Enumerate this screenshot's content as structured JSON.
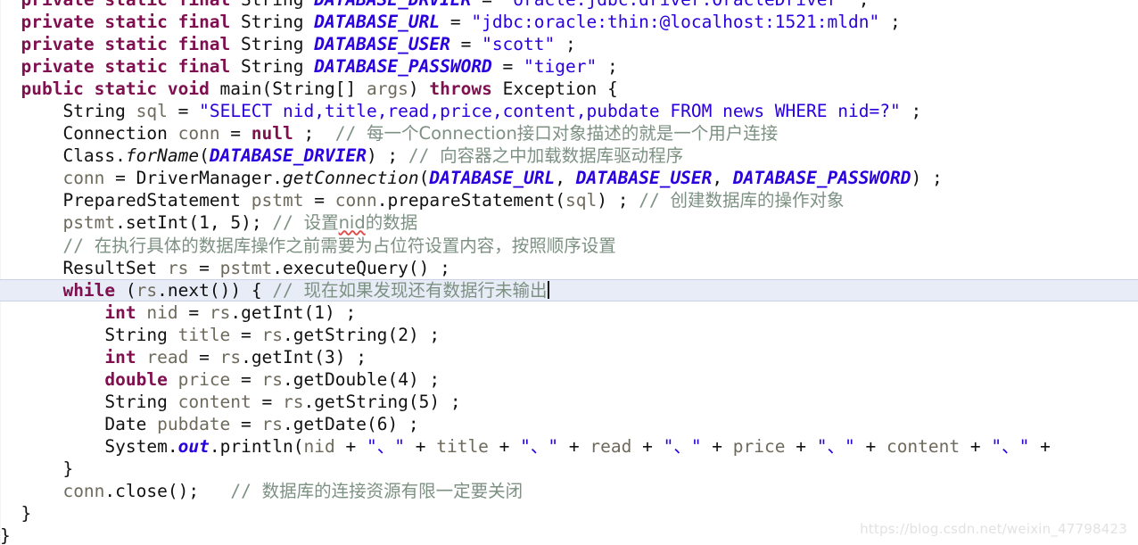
{
  "editor": {
    "language": "Java",
    "theme": {
      "background": "#ffffff",
      "keyword": "#7f0f4f",
      "string": "#2b00de",
      "comment": "#7d9183",
      "field": "#2b00de",
      "variable": "#6e6a5c",
      "text": "#111111",
      "line_highlight": "#e8ecf7",
      "spellcheck_underline": "#e04b4b",
      "watermark": "#e2e2e2"
    },
    "caret_line_index": 11,
    "caret_after_text": "现在如果发现还有数据行未输出"
  },
  "watermark": {
    "text": "https://blog.csdn.net/weixin_47798423"
  },
  "code": {
    "lines": [
      {
        "index": 0,
        "clipped": true,
        "indent": "  ",
        "tokens": [
          {
            "t": "kw",
            "v": "private static final "
          },
          {
            "t": "typ",
            "v": "String "
          },
          {
            "t": "fld",
            "v": "DATABASE_DRVIER"
          },
          {
            "t": "pun",
            "v": " = "
          },
          {
            "t": "str",
            "v": "\"oracle.jdbc.driver.OracleDriver\""
          },
          {
            "t": "pun",
            "v": " ;"
          }
        ]
      },
      {
        "index": 1,
        "indent": "  ",
        "tokens": [
          {
            "t": "kw",
            "v": "private static final "
          },
          {
            "t": "typ",
            "v": "String "
          },
          {
            "t": "fld",
            "v": "DATABASE_URL"
          },
          {
            "t": "pun",
            "v": " = "
          },
          {
            "t": "str",
            "v": "\"jdbc:oracle:thin:@localhost:1521:mldn\""
          },
          {
            "t": "pun",
            "v": " ;"
          }
        ]
      },
      {
        "index": 2,
        "indent": "  ",
        "tokens": [
          {
            "t": "kw",
            "v": "private static final "
          },
          {
            "t": "typ",
            "v": "String "
          },
          {
            "t": "fld",
            "v": "DATABASE_USER"
          },
          {
            "t": "pun",
            "v": " = "
          },
          {
            "t": "str",
            "v": "\"scott\""
          },
          {
            "t": "pun",
            "v": " ;"
          }
        ]
      },
      {
        "index": 3,
        "indent": "  ",
        "tokens": [
          {
            "t": "kw",
            "v": "private static final "
          },
          {
            "t": "typ",
            "v": "String "
          },
          {
            "t": "fld",
            "v": "DATABASE_PASSWORD"
          },
          {
            "t": "pun",
            "v": " = "
          },
          {
            "t": "str",
            "v": "\"tiger\""
          },
          {
            "t": "pun",
            "v": " ;"
          }
        ]
      },
      {
        "index": 4,
        "indent": "  ",
        "tokens": [
          {
            "t": "kw",
            "v": "public static void "
          },
          {
            "t": "typ",
            "v": "main"
          },
          {
            "t": "pun",
            "v": "("
          },
          {
            "t": "typ",
            "v": "String"
          },
          {
            "t": "pun",
            "v": "[] "
          },
          {
            "t": "var",
            "v": "args"
          },
          {
            "t": "pun",
            "v": ") "
          },
          {
            "t": "kw",
            "v": "throws "
          },
          {
            "t": "typ",
            "v": "Exception"
          },
          {
            "t": "pun",
            "v": " {"
          }
        ]
      },
      {
        "index": 5,
        "indent": "      ",
        "tokens": [
          {
            "t": "typ",
            "v": "String "
          },
          {
            "t": "var",
            "v": "sql"
          },
          {
            "t": "pun",
            "v": " = "
          },
          {
            "t": "str",
            "v": "\"SELECT nid,title,read,price,content,pubdate FROM news WHERE nid=?\""
          },
          {
            "t": "pun",
            "v": " ;"
          }
        ]
      },
      {
        "index": 6,
        "indent": "      ",
        "tokens": [
          {
            "t": "typ",
            "v": "Connection "
          },
          {
            "t": "var",
            "v": "conn"
          },
          {
            "t": "pun",
            "v": " = "
          },
          {
            "t": "kw",
            "v": "null"
          },
          {
            "t": "pun",
            "v": " ;  "
          },
          {
            "t": "cmt",
            "v": "// "
          },
          {
            "t": "cmt-cn",
            "v": "每一个Connection接口对象描述的就是一个用户连接"
          }
        ]
      },
      {
        "index": 7,
        "indent": "      ",
        "tokens": [
          {
            "t": "typ",
            "v": "Class"
          },
          {
            "t": "pun",
            "v": "."
          },
          {
            "t": "smeth",
            "v": "forName"
          },
          {
            "t": "pun",
            "v": "("
          },
          {
            "t": "fld",
            "v": "DATABASE_DRVIER"
          },
          {
            "t": "pun",
            "v": ") ; "
          },
          {
            "t": "cmt",
            "v": "// "
          },
          {
            "t": "cmt-cn",
            "v": "向容器之中加载数据库驱动程序"
          }
        ]
      },
      {
        "index": 8,
        "indent": "      ",
        "tokens": [
          {
            "t": "var",
            "v": "conn"
          },
          {
            "t": "pun",
            "v": " = "
          },
          {
            "t": "typ",
            "v": "DriverManager"
          },
          {
            "t": "pun",
            "v": "."
          },
          {
            "t": "smeth",
            "v": "getConnection"
          },
          {
            "t": "pun",
            "v": "("
          },
          {
            "t": "fld",
            "v": "DATABASE_URL"
          },
          {
            "t": "pun",
            "v": ", "
          },
          {
            "t": "fld",
            "v": "DATABASE_USER"
          },
          {
            "t": "pun",
            "v": ", "
          },
          {
            "t": "fld",
            "v": "DATABASE_PASSWORD"
          },
          {
            "t": "pun",
            "v": ") ;"
          }
        ]
      },
      {
        "index": 9,
        "indent": "      ",
        "tokens": [
          {
            "t": "typ",
            "v": "PreparedStatement "
          },
          {
            "t": "var",
            "v": "pstmt"
          },
          {
            "t": "pun",
            "v": " = "
          },
          {
            "t": "var",
            "v": "conn"
          },
          {
            "t": "pun",
            "v": "."
          },
          {
            "t": "typ",
            "v": "prepareStatement"
          },
          {
            "t": "pun",
            "v": "("
          },
          {
            "t": "var",
            "v": "sql"
          },
          {
            "t": "pun",
            "v": ") ; "
          },
          {
            "t": "cmt",
            "v": "// "
          },
          {
            "t": "cmt-cn",
            "v": "创建数据库的操作对象"
          }
        ]
      },
      {
        "index": 10,
        "indent": "      ",
        "tokens": [
          {
            "t": "var",
            "v": "pstmt"
          },
          {
            "t": "pun",
            "v": "."
          },
          {
            "t": "typ",
            "v": "setInt"
          },
          {
            "t": "pun",
            "v": "("
          },
          {
            "t": "num",
            "v": "1"
          },
          {
            "t": "pun",
            "v": ", "
          },
          {
            "t": "num",
            "v": "5"
          },
          {
            "t": "pun",
            "v": "); "
          },
          {
            "t": "cmt",
            "v": "// "
          },
          {
            "t": "cmt-cn",
            "v": "设置"
          },
          {
            "t": "cmt-cn-spell",
            "v": "nid"
          },
          {
            "t": "cmt-cn",
            "v": "的数据"
          }
        ]
      },
      {
        "index": 11,
        "indent": "      ",
        "tokens": [
          {
            "t": "cmt",
            "v": "// "
          },
          {
            "t": "cmt-cn",
            "v": "在执行具体的数据库操作之前需要为占位符设置内容，按照顺序设置"
          }
        ]
      },
      {
        "index": 12,
        "indent": "      ",
        "tokens": [
          {
            "t": "typ",
            "v": "ResultSet "
          },
          {
            "t": "var",
            "v": "rs"
          },
          {
            "t": "pun",
            "v": " = "
          },
          {
            "t": "var",
            "v": "pstmt"
          },
          {
            "t": "pun",
            "v": "."
          },
          {
            "t": "typ",
            "v": "executeQuery"
          },
          {
            "t": "pun",
            "v": "() ;"
          }
        ]
      },
      {
        "index": 13,
        "highlight": true,
        "caret": true,
        "indent": "      ",
        "tokens": [
          {
            "t": "kw",
            "v": "while "
          },
          {
            "t": "pun",
            "v": "("
          },
          {
            "t": "var",
            "v": "rs"
          },
          {
            "t": "pun",
            "v": "."
          },
          {
            "t": "typ",
            "v": "next"
          },
          {
            "t": "pun",
            "v": "()) { "
          },
          {
            "t": "cmt",
            "v": "// "
          },
          {
            "t": "cmt-cn",
            "v": "现在如果发现还有数据行未输出"
          }
        ]
      },
      {
        "index": 14,
        "indent": "          ",
        "tokens": [
          {
            "t": "kw",
            "v": "int "
          },
          {
            "t": "var",
            "v": "nid"
          },
          {
            "t": "pun",
            "v": " = "
          },
          {
            "t": "var",
            "v": "rs"
          },
          {
            "t": "pun",
            "v": "."
          },
          {
            "t": "typ",
            "v": "getInt"
          },
          {
            "t": "pun",
            "v": "("
          },
          {
            "t": "num",
            "v": "1"
          },
          {
            "t": "pun",
            "v": ") ;"
          }
        ]
      },
      {
        "index": 15,
        "indent": "          ",
        "tokens": [
          {
            "t": "typ",
            "v": "String "
          },
          {
            "t": "var",
            "v": "title"
          },
          {
            "t": "pun",
            "v": " = "
          },
          {
            "t": "var",
            "v": "rs"
          },
          {
            "t": "pun",
            "v": "."
          },
          {
            "t": "typ",
            "v": "getString"
          },
          {
            "t": "pun",
            "v": "("
          },
          {
            "t": "num",
            "v": "2"
          },
          {
            "t": "pun",
            "v": ") ;"
          }
        ]
      },
      {
        "index": 16,
        "indent": "          ",
        "tokens": [
          {
            "t": "kw",
            "v": "int "
          },
          {
            "t": "var",
            "v": "read"
          },
          {
            "t": "pun",
            "v": " = "
          },
          {
            "t": "var",
            "v": "rs"
          },
          {
            "t": "pun",
            "v": "."
          },
          {
            "t": "typ",
            "v": "getInt"
          },
          {
            "t": "pun",
            "v": "("
          },
          {
            "t": "num",
            "v": "3"
          },
          {
            "t": "pun",
            "v": ") ;"
          }
        ]
      },
      {
        "index": 17,
        "indent": "          ",
        "tokens": [
          {
            "t": "kw",
            "v": "double "
          },
          {
            "t": "var",
            "v": "price"
          },
          {
            "t": "pun",
            "v": " = "
          },
          {
            "t": "var",
            "v": "rs"
          },
          {
            "t": "pun",
            "v": "."
          },
          {
            "t": "typ",
            "v": "getDouble"
          },
          {
            "t": "pun",
            "v": "("
          },
          {
            "t": "num",
            "v": "4"
          },
          {
            "t": "pun",
            "v": ") ;"
          }
        ]
      },
      {
        "index": 18,
        "indent": "          ",
        "tokens": [
          {
            "t": "typ",
            "v": "String "
          },
          {
            "t": "var",
            "v": "content"
          },
          {
            "t": "pun",
            "v": " = "
          },
          {
            "t": "var",
            "v": "rs"
          },
          {
            "t": "pun",
            "v": "."
          },
          {
            "t": "typ",
            "v": "getString"
          },
          {
            "t": "pun",
            "v": "("
          },
          {
            "t": "num",
            "v": "5"
          },
          {
            "t": "pun",
            "v": ") ;"
          }
        ]
      },
      {
        "index": 19,
        "indent": "          ",
        "tokens": [
          {
            "t": "typ",
            "v": "Date "
          },
          {
            "t": "var",
            "v": "pubdate"
          },
          {
            "t": "pun",
            "v": " = "
          },
          {
            "t": "var",
            "v": "rs"
          },
          {
            "t": "pun",
            "v": "."
          },
          {
            "t": "typ",
            "v": "getDate"
          },
          {
            "t": "pun",
            "v": "("
          },
          {
            "t": "num",
            "v": "6"
          },
          {
            "t": "pun",
            "v": ") ;"
          }
        ]
      },
      {
        "index": 20,
        "indent": "          ",
        "clipped_right": true,
        "tokens": [
          {
            "t": "typ",
            "v": "System"
          },
          {
            "t": "pun",
            "v": "."
          },
          {
            "t": "sfld",
            "v": "out"
          },
          {
            "t": "pun",
            "v": "."
          },
          {
            "t": "typ",
            "v": "println"
          },
          {
            "t": "pun",
            "v": "("
          },
          {
            "t": "var",
            "v": "nid"
          },
          {
            "t": "pun",
            "v": " + "
          },
          {
            "t": "str",
            "v": "\"、\""
          },
          {
            "t": "pun",
            "v": " + "
          },
          {
            "t": "var",
            "v": "title"
          },
          {
            "t": "pun",
            "v": " + "
          },
          {
            "t": "str",
            "v": "\"、\""
          },
          {
            "t": "pun",
            "v": " + "
          },
          {
            "t": "var",
            "v": "read"
          },
          {
            "t": "pun",
            "v": " + "
          },
          {
            "t": "str",
            "v": "\"、\""
          },
          {
            "t": "pun",
            "v": " + "
          },
          {
            "t": "var",
            "v": "price"
          },
          {
            "t": "pun",
            "v": " + "
          },
          {
            "t": "str",
            "v": "\"、\""
          },
          {
            "t": "pun",
            "v": " + "
          },
          {
            "t": "var",
            "v": "content"
          },
          {
            "t": "pun",
            "v": " + "
          },
          {
            "t": "str",
            "v": "\"、\""
          },
          {
            "t": "pun",
            "v": " +"
          }
        ]
      },
      {
        "index": 21,
        "indent": "      ",
        "tokens": [
          {
            "t": "pun",
            "v": "}"
          }
        ]
      },
      {
        "index": 22,
        "indent": "      ",
        "tokens": [
          {
            "t": "var",
            "v": "conn"
          },
          {
            "t": "pun",
            "v": "."
          },
          {
            "t": "typ",
            "v": "close"
          },
          {
            "t": "pun",
            "v": "();   "
          },
          {
            "t": "cmt",
            "v": "// "
          },
          {
            "t": "cmt-cn",
            "v": "数据库的连接资源有限一定要关闭"
          }
        ]
      },
      {
        "index": 23,
        "indent": "  ",
        "tokens": [
          {
            "t": "pun",
            "v": "}"
          }
        ]
      },
      {
        "index": 24,
        "indent": "",
        "clipped": true,
        "tokens": [
          {
            "t": "pun",
            "v": "}"
          }
        ]
      }
    ]
  }
}
